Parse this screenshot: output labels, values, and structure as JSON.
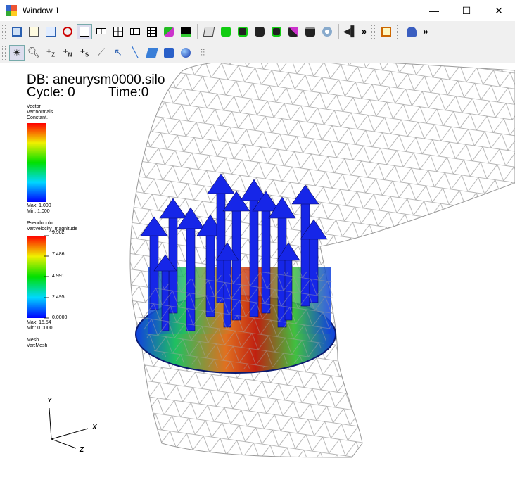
{
  "window": {
    "title": "Window 1",
    "minimize": "—",
    "maximize": "☐",
    "close": "✕"
  },
  "toolbar": {
    "overflow1": "»",
    "overflow2": "»"
  },
  "header": {
    "db": "DB: aneurysm0000.silo",
    "cycle": "Cycle: 0",
    "time": "Time:0"
  },
  "legend_vector": {
    "title": "Vector",
    "var": "Var:normals",
    "mode": "Constant.",
    "max": "Max: 1.000",
    "min": "Min: 1.000"
  },
  "legend_pseudo": {
    "title": "Pseudocolor",
    "var": "Var:velocity_magnitude",
    "ticks": [
      "9.982",
      "7.486",
      "4.991",
      "2.495",
      "0.0000"
    ],
    "max": "Max: 15.54",
    "min": "Min: 0.0000"
  },
  "legend_mesh": {
    "title": "Mesh",
    "var": "Var:Mesh"
  },
  "axes": {
    "x": "X",
    "y": "Y",
    "z": "Z"
  },
  "colors": {
    "glyph": "#1020e0",
    "mesh": "#9a9a9a",
    "accent": "#2a5fb0"
  }
}
